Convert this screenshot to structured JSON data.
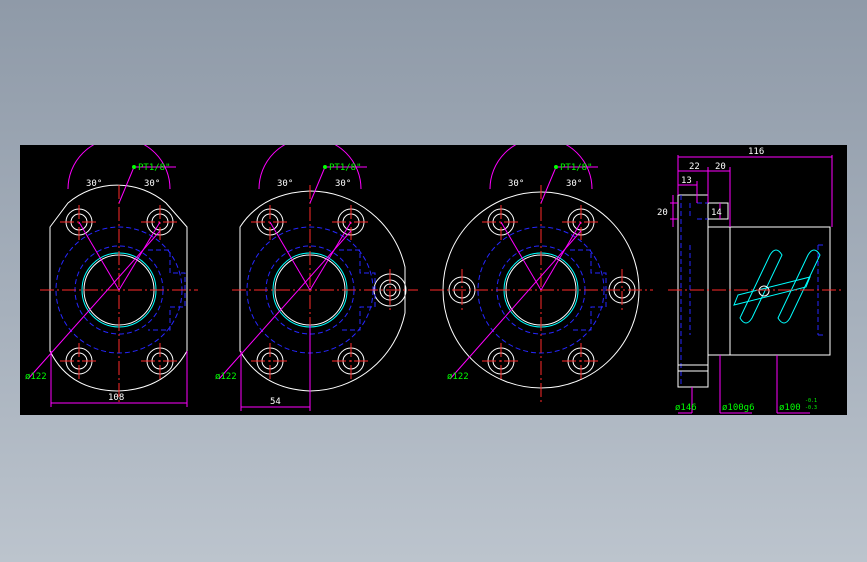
{
  "views": {
    "front_a": {
      "angle_left": "30°",
      "angle_right": "30°",
      "port": "PT1/8\"",
      "pcd": "ø122",
      "width_dim": "108"
    },
    "front_b": {
      "angle_left": "30°",
      "angle_right": "30°",
      "port": "PT1/8\"",
      "pcd": "ø122",
      "offset_dim": "54"
    },
    "front_c": {
      "angle_left": "30°",
      "angle_right": "30°",
      "port": "PT1/8\"",
      "pcd": "ø122"
    },
    "side": {
      "overall_length": "116",
      "dim_22": "22",
      "dim_20_top": "20",
      "dim_13": "13",
      "dim_20_left": "20",
      "dim_14": "14",
      "flange_dia": "ø146",
      "spigot_dia": "ø100g6",
      "body_dia": "ø100",
      "body_tol_upper": "-0.1",
      "body_tol_lower": "-0.3"
    }
  },
  "colors": {
    "background": "#000000",
    "outline": "#ffffff",
    "hidden": "#2626ff",
    "center": "#ff2a2a",
    "dimension": "#ff00ff",
    "text": "#00ff00",
    "thread": "#00ffff"
  }
}
